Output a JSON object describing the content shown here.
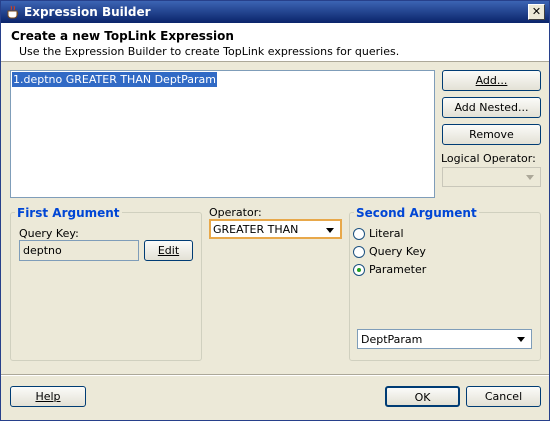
{
  "window": {
    "title": "Expression Builder",
    "close_glyph": "✕"
  },
  "header": {
    "title": "Create a new TopLink Expression",
    "description": "Use the Expression Builder to create TopLink expressions for queries."
  },
  "expressions": [
    "1.deptno GREATER THAN DeptParam"
  ],
  "side_buttons": {
    "add": "Add...",
    "add_nested": "Add Nested...",
    "remove": "Remove"
  },
  "logical_operator": {
    "label": "Logical Operator:",
    "value": ""
  },
  "first_argument": {
    "title": "First Argument",
    "query_key_label": "Query Key:",
    "query_key_value": "deptno",
    "edit_label": "Edit"
  },
  "operator": {
    "label": "Operator:",
    "value": "GREATER THAN"
  },
  "second_argument": {
    "title": "Second Argument",
    "options": [
      "Literal",
      "Query Key",
      "Parameter"
    ],
    "selected": "Parameter",
    "parameter_value": "DeptParam"
  },
  "footer": {
    "help": "Help",
    "ok": "OK",
    "cancel": "Cancel"
  },
  "colors": {
    "title_bar": "#0a246a",
    "selection": "#316ac5",
    "group_title": "#0046d5"
  }
}
